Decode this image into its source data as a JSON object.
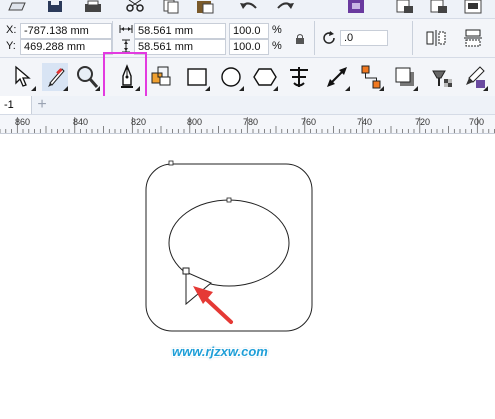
{
  "property_bar": {
    "x_label": "X:",
    "x_value": "-787.138 mm",
    "y_label": "Y:",
    "y_value": "469.288 mm",
    "width_value": "58.561 mm",
    "height_value": "58.561 mm",
    "scale_x": "100.0",
    "scale_y": "100.0",
    "percent_unit": "%",
    "rotation_value": ".0"
  },
  "page_tab": {
    "label": "-1",
    "add_label": "+"
  },
  "ruler": {
    "labels": [
      "860",
      "840",
      "820",
      "800",
      "780",
      "760",
      "740",
      "720",
      "700"
    ]
  },
  "watermark": {
    "text": "www.rjzxw.com"
  },
  "tools": [
    {
      "name": "pick-tool-icon"
    },
    {
      "name": "shape-tool-icon"
    },
    {
      "name": "crop-tool-icon"
    },
    {
      "name": "zoom-tool-icon"
    },
    {
      "name": "pen-tool-icon",
      "selected": true
    },
    {
      "name": "smart-fill-icon"
    },
    {
      "name": "rectangle-tool-icon"
    },
    {
      "name": "ellipse-tool-icon"
    },
    {
      "name": "polygon-tool-icon"
    },
    {
      "name": "text-tool-icon"
    },
    {
      "name": "dimension-tool-icon"
    },
    {
      "name": "connector-tool-icon"
    },
    {
      "name": "drop-shadow-tool-icon"
    },
    {
      "name": "transparency-tool-icon"
    },
    {
      "name": "color-eyedropper-icon"
    }
  ],
  "colors": {
    "highlight": "#e33ae0",
    "accent_purple": "#6a3a9f",
    "watermark": "#1f9fd8",
    "arrow": "#e53935"
  }
}
